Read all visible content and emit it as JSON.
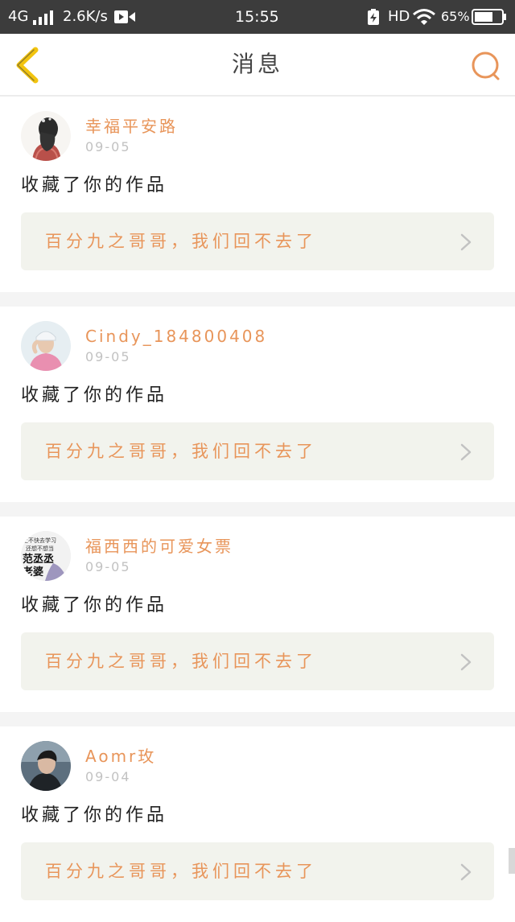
{
  "status_bar": {
    "network": "4G",
    "speed": "2.6K/s",
    "time": "15:55",
    "hd": "HD",
    "battery": "65%"
  },
  "header": {
    "title": "消息",
    "back_icon": "chevron-left-icon",
    "search_icon": "search-icon"
  },
  "colors": {
    "accent": "#e8955a",
    "back_yellow": "#f2c40f",
    "box_bg": "#f2f3ed"
  },
  "messages": [
    {
      "username": "幸福平安路",
      "date": "09-05",
      "action": "收藏了你的作品",
      "work_title": "百分九之哥哥，我们回不去了"
    },
    {
      "username": "Cindy_184800408",
      "date": "09-05",
      "action": "收藏了你的作品",
      "work_title": "百分九之哥哥，我们回不去了"
    },
    {
      "username": "福西西的可爱女票",
      "date": "09-05",
      "action": "收藏了你的作品",
      "work_title": "百分九之哥哥，我们回不去了",
      "avatar_text": [
        "上不快去学习",
        "还想不想当",
        "范丞丞",
        "老婆"
      ]
    },
    {
      "username": "Aomr玫",
      "date": "09-04",
      "action": "收藏了你的作品",
      "work_title": "百分九之哥哥，我们回不去了"
    }
  ]
}
